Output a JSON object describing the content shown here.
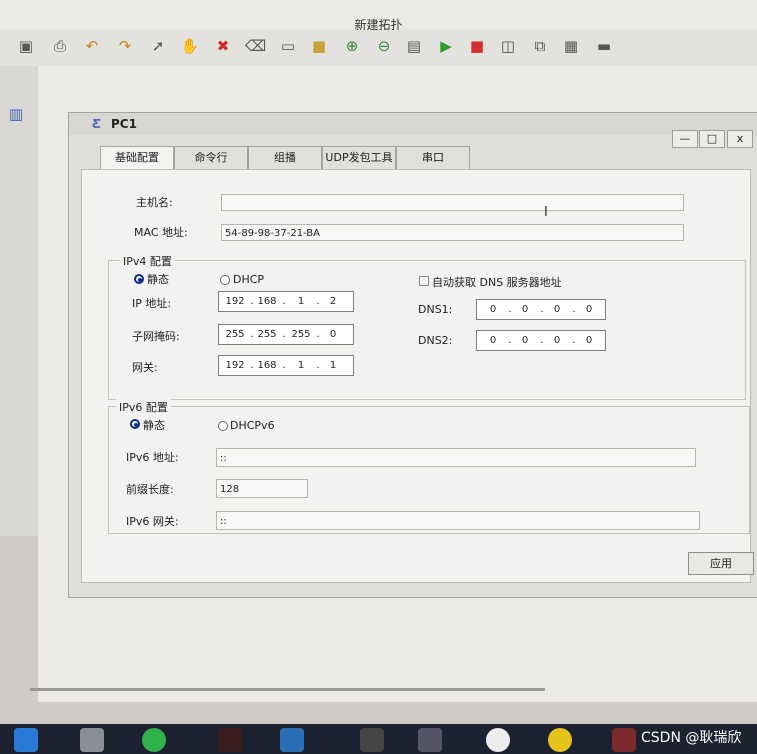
{
  "app": {
    "title": "新建拓扑",
    "toolbar_icons": [
      "save-icon",
      "print-icon",
      "undo-icon",
      "redo-icon",
      "select-arrow-icon",
      "hand-icon",
      "delete-icon",
      "erase-icon",
      "text-icon",
      "rectangle-icon",
      "zoom-in-icon",
      "zoom-out-icon",
      "topology-icon",
      "start-icon",
      "stop-icon",
      "capture-icon",
      "tree-icon",
      "grid-icon",
      "terminal-icon"
    ]
  },
  "dialog": {
    "title": "PC1",
    "window_buttons": {
      "minimize": "—",
      "maximize": "□",
      "close": "x"
    },
    "tabs": [
      {
        "label": "基础配置",
        "active": true
      },
      {
        "label": "命令行",
        "active": false
      },
      {
        "label": "组播",
        "active": false
      },
      {
        "label": "UDP发包工具",
        "active": false
      },
      {
        "label": "串口",
        "active": false
      }
    ],
    "basic": {
      "hostname_label": "主机名:",
      "hostname_value": "",
      "mac_label": "MAC 地址:",
      "mac_value": "54-89-98-37-21-BA"
    },
    "ipv4": {
      "legend": "IPv4 配置",
      "static_label": "静态",
      "dhcp_label": "DHCP",
      "mode": "静态",
      "auto_dns_label": "自动获取 DNS 服务器地址",
      "auto_dns_checked": false,
      "ip_label": "IP 地址:",
      "ip": [
        "192",
        "168",
        "1",
        "2"
      ],
      "mask_label": "子网掩码:",
      "mask": [
        "255",
        "255",
        "255",
        "0"
      ],
      "gateway_label": "网关:",
      "gateway": [
        "192",
        "168",
        "1",
        "1"
      ],
      "dns1_label": "DNS1:",
      "dns1": [
        "0",
        "0",
        "0",
        "0"
      ],
      "dns2_label": "DNS2:",
      "dns2": [
        "0",
        "0",
        "0",
        "0"
      ]
    },
    "ipv6": {
      "legend": "IPv6 配置",
      "static_label": "静态",
      "dhcp_label": "DHCPv6",
      "mode": "静态",
      "addr_label": "IPv6 地址:",
      "addr_value": "::",
      "prefix_label": "前缀长度:",
      "prefix_value": "128",
      "gateway_label": "IPv6 网关:",
      "gateway_value": "::"
    },
    "apply_label": "应用"
  },
  "watermark": "CSDN @耿瑞欣"
}
